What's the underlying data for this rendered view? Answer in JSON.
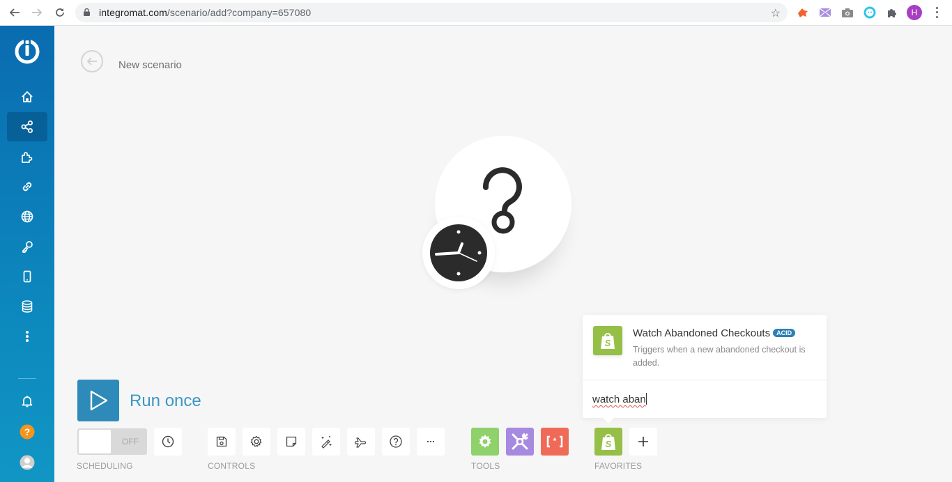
{
  "browser": {
    "url_host": "integromat.com",
    "url_path": "/scenario/add?company=657080",
    "profile_initial": "H",
    "icons": [
      "back-icon",
      "forward-icon",
      "reload-icon",
      "lock-icon",
      "star-icon",
      "fox-extension-icon",
      "mail-extension-icon",
      "camera-extension-icon",
      "bot-extension-icon",
      "puzzle-extensions-icon",
      "profile-avatar",
      "menu-icon"
    ]
  },
  "sidebar": {
    "items": [
      {
        "name": "home",
        "active": false
      },
      {
        "name": "scenarios",
        "active": true
      },
      {
        "name": "templates",
        "active": false
      },
      {
        "name": "connections",
        "active": false
      },
      {
        "name": "webhooks",
        "active": false
      },
      {
        "name": "keys",
        "active": false
      },
      {
        "name": "devices",
        "active": false
      },
      {
        "name": "data-stores",
        "active": false
      },
      {
        "name": "more",
        "active": false
      }
    ],
    "bottom": [
      "notifications",
      "help",
      "user-profile"
    ]
  },
  "header": {
    "title": "New scenario"
  },
  "run": {
    "label": "Run once"
  },
  "scheduling": {
    "toggle_state": "OFF",
    "label": "SCHEDULING"
  },
  "controls": {
    "label": "CONTROLS",
    "buttons": [
      "save",
      "scenario-settings",
      "notes",
      "auto-align",
      "explain-flow",
      "help",
      "more"
    ]
  },
  "tools": {
    "label": "TOOLS",
    "items": [
      {
        "name": "flow-control",
        "color": "#8fd16a"
      },
      {
        "name": "tools",
        "color": "#a68ae0"
      },
      {
        "name": "text-parser",
        "color": "#f06a58"
      }
    ]
  },
  "favorites": {
    "label": "FAVORITES",
    "items": [
      {
        "name": "shopify",
        "color": "#95bf47"
      }
    ],
    "add_label": "+"
  },
  "search_popup": {
    "result_title": "Watch Abandoned Checkouts",
    "result_badge": "ACID",
    "result_description": "Triggers when a new abandoned checkout is added.",
    "query": "watch aban"
  },
  "colors": {
    "sidebar": "#0a6cb0",
    "run_button": "#2e8ab8",
    "run_label": "#3d96c4",
    "shopify": "#95bf47",
    "badge": "#2d7fb6",
    "help_icon": "#f7941d"
  }
}
